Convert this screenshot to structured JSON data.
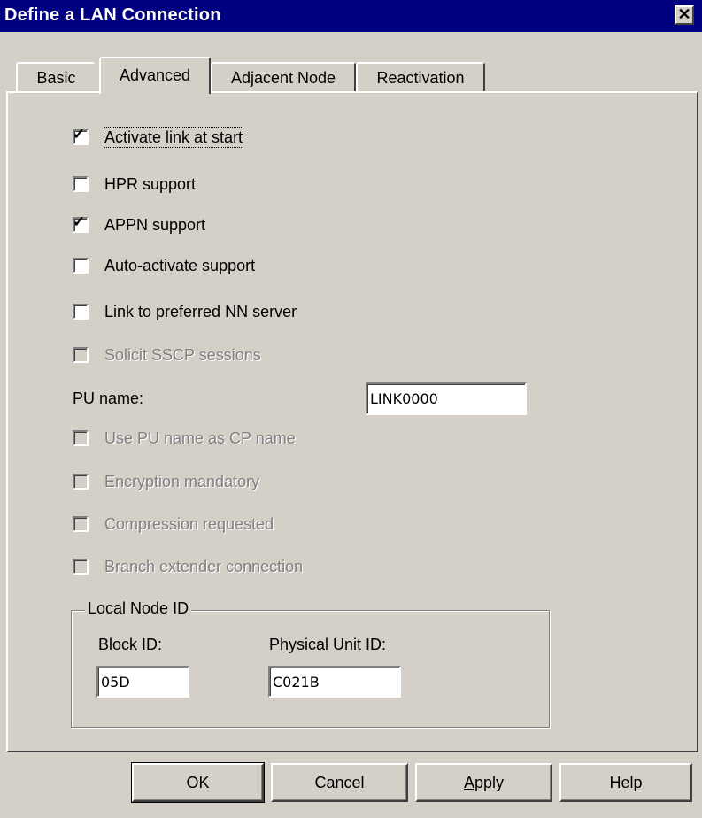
{
  "window": {
    "title": "Define a LAN Connection",
    "close_glyph": "✕"
  },
  "tabs": [
    {
      "label": "Basic",
      "active": false
    },
    {
      "label": "Advanced",
      "active": true
    },
    {
      "label": "Adjacent Node",
      "active": false
    },
    {
      "label": "Reactivation",
      "active": false
    }
  ],
  "checkboxes": [
    {
      "label": "Activate link at start",
      "checked": true,
      "enabled": true
    },
    {
      "label": "HPR support",
      "checked": false,
      "enabled": true
    },
    {
      "label": "APPN support",
      "checked": true,
      "enabled": true
    },
    {
      "label": "Auto-activate support",
      "checked": false,
      "enabled": true
    },
    {
      "label": "Link to preferred NN server",
      "checked": false,
      "enabled": true
    },
    {
      "label": "Solicit SSCP sessions",
      "checked": false,
      "enabled": false
    }
  ],
  "pu_name": {
    "label": "PU name:",
    "value": "LINK0000"
  },
  "checkboxes2": [
    {
      "label": "Use PU name as CP name",
      "checked": false,
      "enabled": false
    },
    {
      "label": "Encryption mandatory",
      "checked": false,
      "enabled": false
    },
    {
      "label": "Compression requested",
      "checked": false,
      "enabled": false
    },
    {
      "label": "Branch extender connection",
      "checked": false,
      "enabled": false
    }
  ],
  "local_node": {
    "group_title": "Local Node ID",
    "block_label": "Block ID:",
    "block_value": "05D",
    "pu_label": "Physical Unit ID:",
    "pu_value": "C021B"
  },
  "buttons": {
    "ok": "OK",
    "cancel": "Cancel",
    "apply_mnemonic": "A",
    "apply_rest": "pply",
    "help": "Help"
  },
  "colors": {
    "titlebar": "#000080",
    "face": "#d4d0c8"
  }
}
